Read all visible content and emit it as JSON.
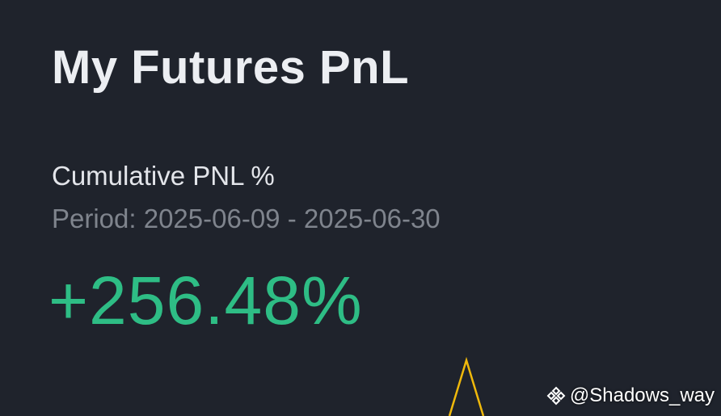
{
  "header": {
    "title": "My Futures PnL"
  },
  "metric": {
    "label": "Cumulative PNL %",
    "period": "Period: 2025-06-09 - 2025-06-30",
    "value": "+256.48%"
  },
  "colors": {
    "background": "#1f232c",
    "positive": "#2ebd85",
    "chart_line": "#f0b90b",
    "muted_text": "#7f848d"
  },
  "watermark": {
    "icon": "binance-diamond-icon",
    "handle": "@Shadows_way"
  }
}
